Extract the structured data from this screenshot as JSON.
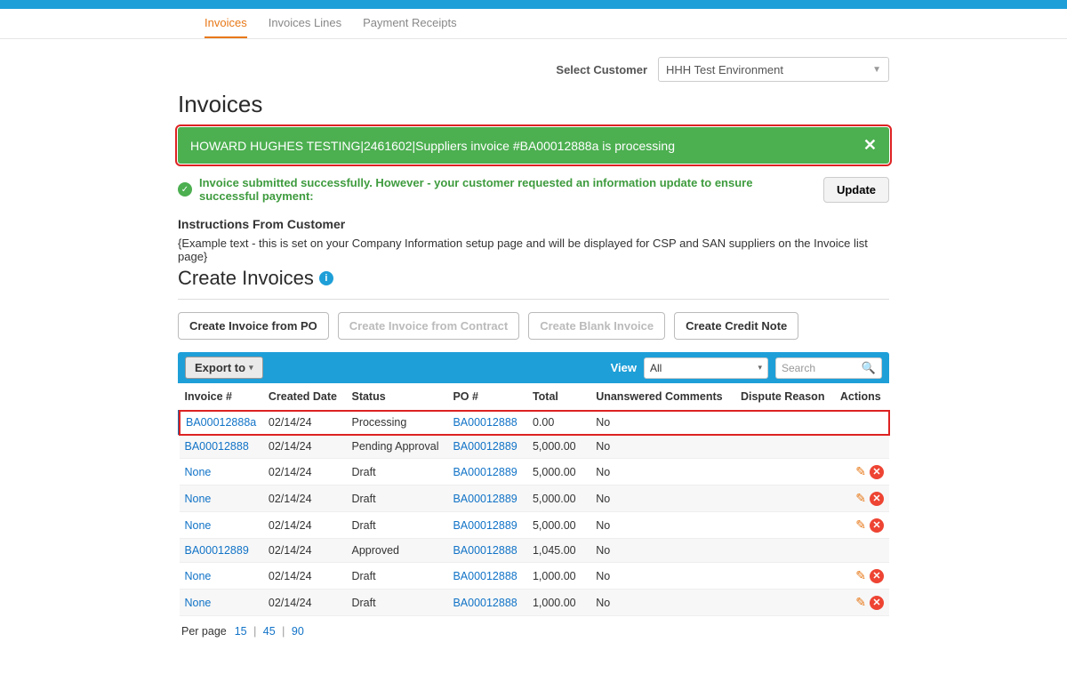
{
  "nav": {
    "tabs": [
      {
        "label": "Invoices",
        "active": true
      },
      {
        "label": "Invoices Lines",
        "active": false
      },
      {
        "label": "Payment Receipts",
        "active": false
      }
    ]
  },
  "customer": {
    "label": "Select Customer",
    "selected": "HHH Test Environment"
  },
  "page": {
    "title": "Invoices"
  },
  "banner": {
    "text": "HOWARD HUGHES TESTING|2461602|Suppliers invoice #BA00012888a is processing"
  },
  "success": {
    "message": "Invoice submitted successfully. However - your customer requested an information update to ensure successful payment:",
    "update_label": "Update"
  },
  "instructions": {
    "heading": "Instructions From Customer",
    "text": "{Example text - this is set on your Company Information setup page and will be displayed for CSP and SAN suppliers on the Invoice list page}"
  },
  "create": {
    "title": "Create Invoices"
  },
  "buttons": {
    "from_po": "Create Invoice from PO",
    "from_contract": "Create Invoice from Contract",
    "blank": "Create Blank Invoice",
    "credit_note": "Create Credit Note"
  },
  "toolbar": {
    "export_label": "Export to",
    "view_label": "View",
    "view_selected": "All",
    "search_placeholder": "Search"
  },
  "columns": {
    "invoice": "Invoice #",
    "created": "Created Date",
    "status": "Status",
    "po": "PO #",
    "total": "Total",
    "unanswered": "Unanswered Comments",
    "dispute": "Dispute Reason",
    "actions": "Actions"
  },
  "rows": [
    {
      "invoice": "BA00012888a",
      "created": "02/14/24",
      "status": "Processing",
      "po": "BA00012888",
      "total": "0.00",
      "unanswered": "No",
      "dispute": "",
      "has_actions": false,
      "hl": true
    },
    {
      "invoice": "BA00012888",
      "created": "02/14/24",
      "status": "Pending Approval",
      "po": "BA00012889",
      "total": "5,000.00",
      "unanswered": "No",
      "dispute": "",
      "has_actions": false,
      "hl": false
    },
    {
      "invoice": "None",
      "created": "02/14/24",
      "status": "Draft",
      "po": "BA00012889",
      "total": "5,000.00",
      "unanswered": "No",
      "dispute": "",
      "has_actions": true,
      "hl": false
    },
    {
      "invoice": "None",
      "created": "02/14/24",
      "status": "Draft",
      "po": "BA00012889",
      "total": "5,000.00",
      "unanswered": "No",
      "dispute": "",
      "has_actions": true,
      "hl": false
    },
    {
      "invoice": "None",
      "created": "02/14/24",
      "status": "Draft",
      "po": "BA00012889",
      "total": "5,000.00",
      "unanswered": "No",
      "dispute": "",
      "has_actions": true,
      "hl": false
    },
    {
      "invoice": "BA00012889",
      "created": "02/14/24",
      "status": "Approved",
      "po": "BA00012888",
      "total": "1,045.00",
      "unanswered": "No",
      "dispute": "",
      "has_actions": false,
      "hl": false
    },
    {
      "invoice": "None",
      "created": "02/14/24",
      "status": "Draft",
      "po": "BA00012888",
      "total": "1,000.00",
      "unanswered": "No",
      "dispute": "",
      "has_actions": true,
      "hl": false
    },
    {
      "invoice": "None",
      "created": "02/14/24",
      "status": "Draft",
      "po": "BA00012888",
      "total": "1,000.00",
      "unanswered": "No",
      "dispute": "",
      "has_actions": true,
      "hl": false
    }
  ],
  "pager": {
    "label": "Per page",
    "options": [
      "15",
      "45",
      "90"
    ]
  }
}
